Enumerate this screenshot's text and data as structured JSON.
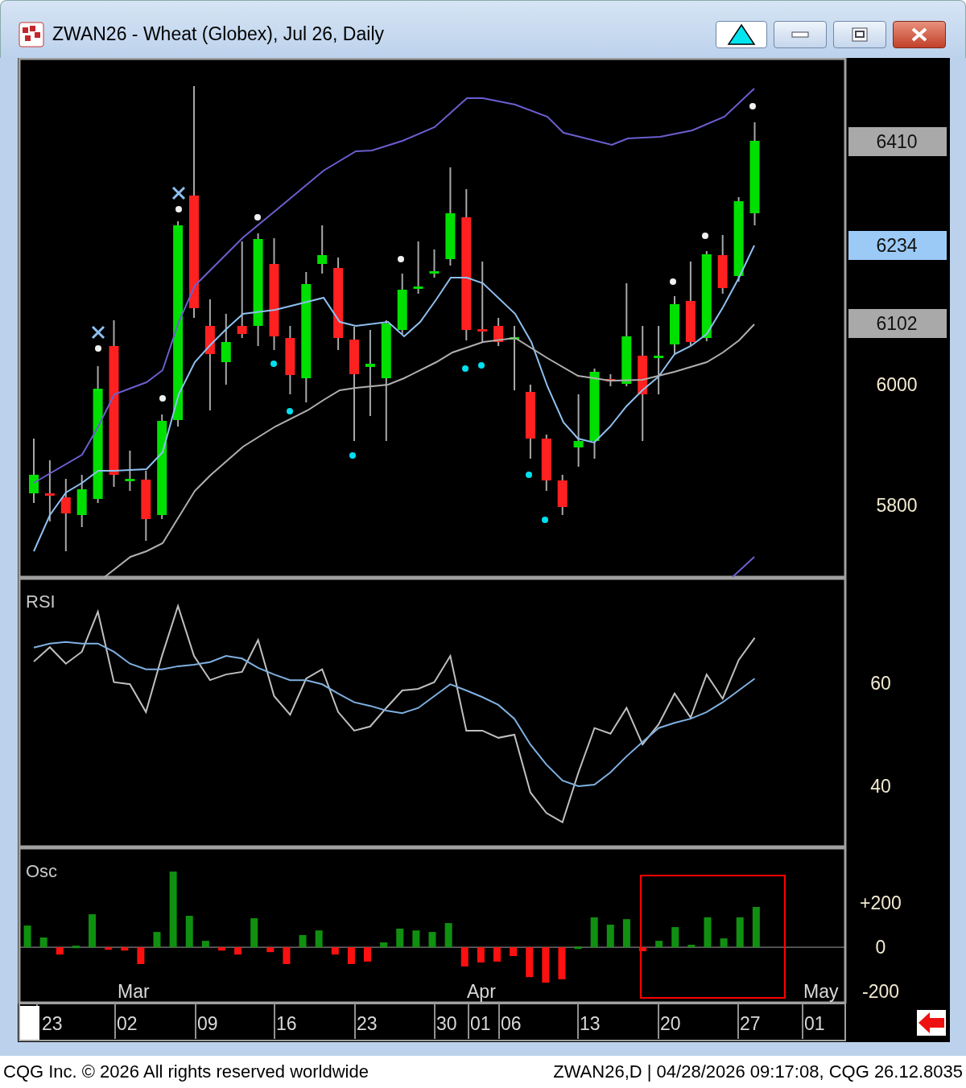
{
  "window": {
    "title": "ZWAN26 - Wheat (Globex), Jul 26, Daily"
  },
  "price_panel": {
    "axis": [
      {
        "text": "6410",
        "kind": "tag"
      },
      {
        "text": "6234",
        "kind": "last"
      },
      {
        "text": "6102",
        "kind": "tag"
      },
      {
        "text": "6000",
        "kind": "label"
      },
      {
        "text": "5800",
        "kind": "label"
      }
    ]
  },
  "rsi_panel": {
    "title": "RSI",
    "axis_labels": [
      "60",
      "40"
    ]
  },
  "osc_panel": {
    "title": "Osc",
    "chart_data": {
      "type": "bar",
      "categories": [
        null,
        null,
        null,
        null,
        null,
        null,
        null,
        null,
        null,
        null,
        null,
        null,
        null,
        null,
        null,
        null,
        null,
        null,
        null,
        null,
        null,
        null,
        null,
        null,
        null,
        null,
        null,
        null,
        null,
        null,
        null,
        null,
        null,
        null,
        null,
        null,
        null,
        null,
        null,
        null,
        null,
        null,
        null,
        null,
        null,
        null,
        null,
        null,
        null,
        null,
        null
      ],
      "values": [
        98,
        44,
        -33,
        7,
        149,
        -11,
        -15,
        -76,
        69,
        342,
        142,
        29,
        -15,
        -33,
        131,
        -22,
        -76,
        55,
        76,
        -33,
        -76,
        -65,
        22,
        84,
        76,
        69,
        109,
        -87,
        -69,
        -65,
        -40,
        -135,
        -160,
        -145,
        3,
        135,
        102,
        127,
        -18,
        29,
        91,
        11,
        135,
        40,
        135,
        182,
        null,
        null,
        null,
        null,
        null
      ],
      "ylim": [
        -247,
        444
      ],
      "yticks": [
        {
          "value": 200,
          "label": "+200"
        },
        {
          "value": 0,
          "label": "0"
        },
        {
          "value": -200,
          "label": "-200"
        }
      ]
    }
  },
  "date_axis": {
    "months": [
      "Mar",
      "Apr",
      "May"
    ],
    "days": [
      "23",
      "02",
      "09",
      "16",
      "23",
      "30",
      "01",
      "06",
      "13",
      "20",
      "27",
      "01"
    ]
  },
  "status_bar": {
    "left": "CQG Inc. © 2026 All rights reserved worldwide",
    "right": "ZWAN26,D | 04/28/2026 09:17:08, CQG 26.12.8035"
  }
}
